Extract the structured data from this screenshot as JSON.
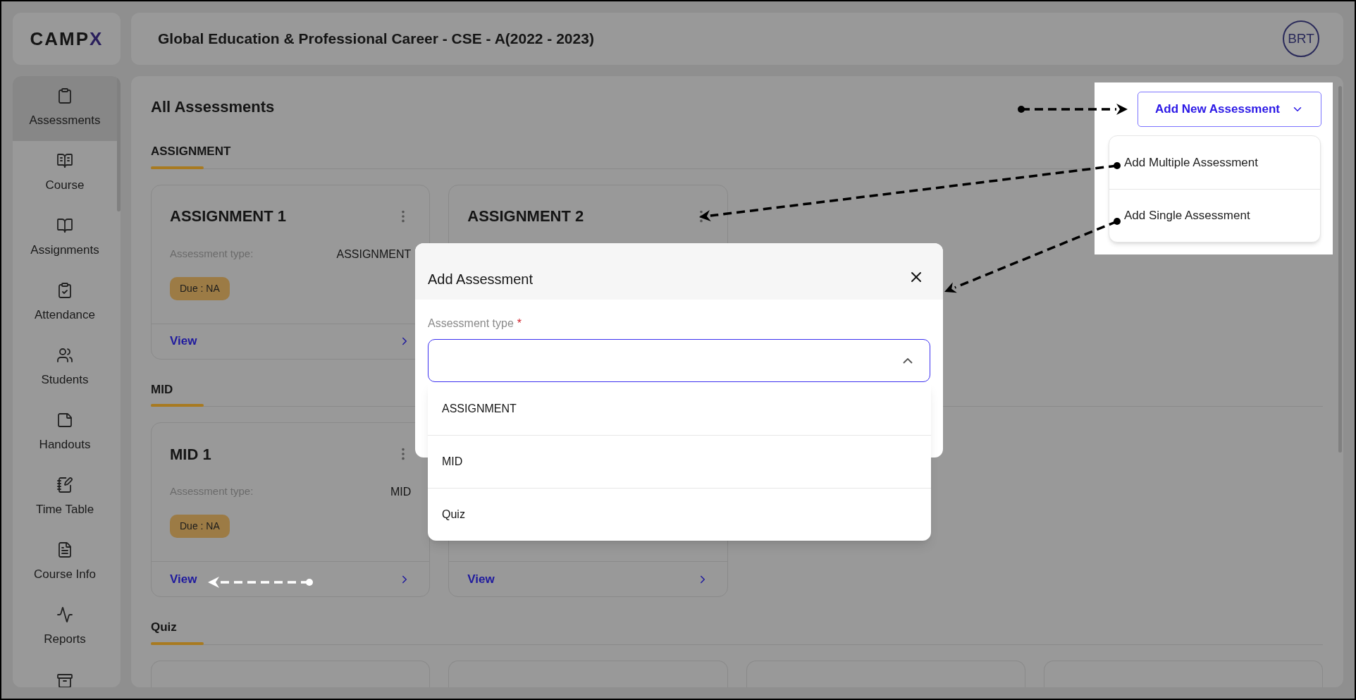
{
  "brand": {
    "logo": "CAMP",
    "logo_accent": "X"
  },
  "header": {
    "title": "Global Education & Professional Career - CSE - A(2022 - 2023)",
    "avatar": "BRT"
  },
  "sidebar": {
    "items": [
      {
        "label": "Assessments",
        "selected": true
      },
      {
        "label": "Course",
        "selected": false
      },
      {
        "label": "Assignments",
        "selected": false
      },
      {
        "label": "Attendance",
        "selected": false
      },
      {
        "label": "Students",
        "selected": false
      },
      {
        "label": "Handouts",
        "selected": false
      },
      {
        "label": "Time Table",
        "selected": false
      },
      {
        "label": "Course Info",
        "selected": false
      },
      {
        "label": "Reports",
        "selected": false
      }
    ]
  },
  "page": {
    "title": "All Assessments",
    "add_button": {
      "label": "Add New Assessment",
      "expanded": true
    },
    "menu": [
      {
        "label": "Add Multiple Assessment"
      },
      {
        "label": "Add Single Assessment"
      }
    ]
  },
  "sections": [
    {
      "title": "ASSIGNMENT",
      "cards": [
        {
          "kind": "full",
          "title": "ASSIGNMENT 1",
          "type_label": "Assessment type:",
          "type_value": "ASSIGNMENT",
          "due": "Due : NA",
          "link": "View"
        },
        {
          "kind": "full",
          "title": "ASSIGNMENT 2"
        }
      ]
    },
    {
      "title": "MID",
      "cards": [
        {
          "kind": "full",
          "title": "MID 1",
          "type_label": "Assessment type:",
          "type_value": "MID",
          "due": "Due : NA",
          "link": "View"
        },
        {
          "kind": "full",
          "link": "View"
        }
      ]
    },
    {
      "title": "Quiz",
      "cards": [
        {
          "kind": "clipped"
        },
        {
          "kind": "clipped"
        },
        {
          "kind": "clipped"
        },
        {
          "kind": "clipped"
        }
      ]
    }
  ],
  "modal": {
    "title": "Add Assessment",
    "field": {
      "label": "Assessment type",
      "required": true,
      "required_mark": "*",
      "expanded": true
    },
    "options": [
      {
        "label": "ASSIGNMENT",
        "selected": false
      },
      {
        "label": "MID",
        "selected": false
      },
      {
        "label": "Quiz",
        "selected": false
      }
    ]
  }
}
